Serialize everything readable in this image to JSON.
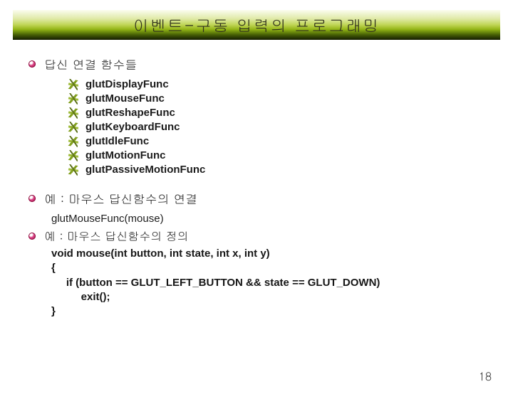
{
  "title": "이벤트-구동 입력의 프로그래밍",
  "section1": "답신 연결 함수들",
  "funcs": {
    "f0": "glutDisplayFunc",
    "f1": "glutMouseFunc",
    "f2": "glutReshapeFunc",
    "f3": "glutKeyboardFunc",
    "f4": "glutIdleFunc",
    "f5": "glutMotionFunc",
    "f6": "glutPassiveMotionFunc"
  },
  "section2": "예 : 마우스 답신함수의 연결",
  "example_call": "glutMouseFunc(mouse)",
  "section3": "예 : 마우스 답신함수의 정의",
  "code": "void mouse(int button, int state, int x, int y)\n{\n     if (button == GLUT_LEFT_BUTTON && state == GLUT_DOWN)\n          exit();\n}",
  "page": "18"
}
